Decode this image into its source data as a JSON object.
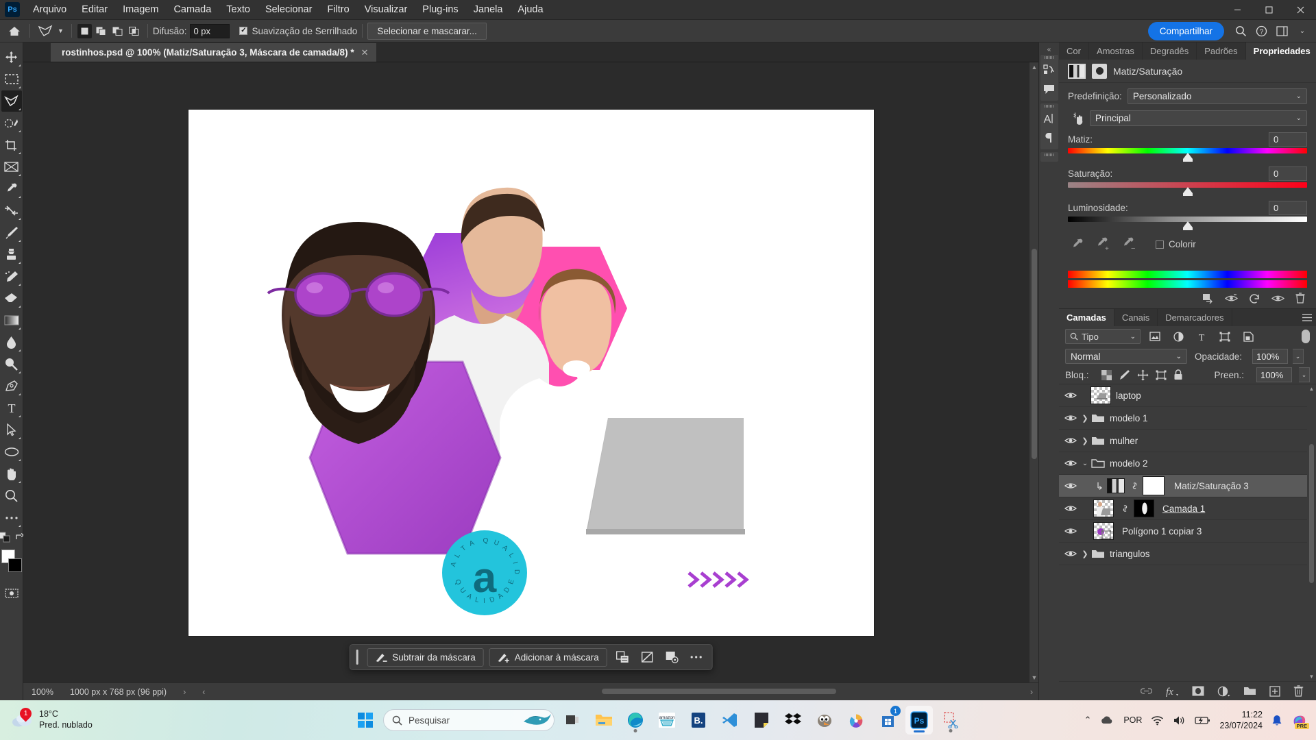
{
  "app": {
    "name": "Photoshop",
    "logo_text": "Ps"
  },
  "menubar": {
    "items": [
      "Arquivo",
      "Editar",
      "Imagem",
      "Camada",
      "Texto",
      "Selecionar",
      "Filtro",
      "Visualizar",
      "Plug-ins",
      "Janela",
      "Ajuda"
    ],
    "window_controls": {
      "minimize": "—",
      "maximize": "▢",
      "close": "✕"
    }
  },
  "optionsbar": {
    "diffusion_label": "Difusão:",
    "diffusion_value": "0 px",
    "antialias_label": "Suavização de Serrilhado",
    "select_mask_button": "Selecionar e mascarar...",
    "share_button": "Compartilhar",
    "icons": [
      "home-icon",
      "lasso-tool-preset-icon",
      "selection-new-icon",
      "selection-add-icon",
      "selection-subtract-icon",
      "selection-intersect-icon",
      "search-icon",
      "help-icon",
      "workspace-icon",
      "more-icon"
    ]
  },
  "toolbar": {
    "tools": [
      {
        "name": "move-tool",
        "active": false
      },
      {
        "name": "marquee-tool",
        "active": false
      },
      {
        "name": "lasso-tool",
        "active": true
      },
      {
        "name": "object-selection-tool",
        "active": false
      },
      {
        "name": "crop-tool",
        "active": false
      },
      {
        "name": "frame-tool",
        "active": false
      },
      {
        "name": "eyedropper-tool",
        "active": false
      },
      {
        "name": "healing-brush-tool",
        "active": false
      },
      {
        "name": "brush-tool",
        "active": false
      },
      {
        "name": "clone-stamp-tool",
        "active": false
      },
      {
        "name": "history-brush-tool",
        "active": false
      },
      {
        "name": "eraser-tool",
        "active": false
      },
      {
        "name": "gradient-tool",
        "active": false
      },
      {
        "name": "blur-tool",
        "active": false
      },
      {
        "name": "dodge-tool",
        "active": false
      },
      {
        "name": "pen-tool",
        "active": false
      },
      {
        "name": "type-tool",
        "active": false
      },
      {
        "name": "path-selection-tool",
        "active": false
      },
      {
        "name": "ellipse-tool",
        "active": false
      },
      {
        "name": "hand-tool",
        "active": false
      },
      {
        "name": "zoom-tool",
        "active": false
      },
      {
        "name": "more-tools",
        "active": false
      }
    ],
    "foreground_color": "#ffffff",
    "background_color": "#000000"
  },
  "document": {
    "tab_title": "rostinhos.psd @ 100% (Matiz/Saturação 3, Máscara de camada/8) *",
    "close_label": "✕",
    "zoom": "100%",
    "dimensions": "1000 px x 768 px (96 ppi)"
  },
  "mask_toolbar": {
    "subtract_label": "Subtrair da máscara",
    "add_label": "Adicionar à máscara",
    "icons": [
      "mask-settings-icon",
      "mask-disable-icon",
      "mask-apply-icon",
      "more-options-icon"
    ]
  },
  "minidock": {
    "collapse_label": "«",
    "icons": [
      "libraries-icon",
      "comments-icon",
      "character-icon",
      "paragraph-icon"
    ]
  },
  "properties": {
    "tabs": [
      "Cor",
      "Amostras",
      "Degradês",
      "Padrões",
      "Propriedades"
    ],
    "active_tab": "Propriedades",
    "adjustment_title": "Matiz/Saturação",
    "preset_label": "Predefinição:",
    "preset_value": "Personalizado",
    "channel_value": "Principal",
    "sliders": [
      {
        "label": "Matiz:",
        "value": "0",
        "track": "hue"
      },
      {
        "label": "Saturação:",
        "value": "0",
        "track": "saturation"
      },
      {
        "label": "Luminosidade:",
        "value": "0",
        "track": "lightness"
      }
    ],
    "colorize_label": "Colorir",
    "colorize_checked": false,
    "footer_icons": [
      "clip-to-layer-icon",
      "toggle-visibility-prev-icon",
      "reset-icon",
      "toggle-layer-visibility-icon",
      "delete-icon"
    ]
  },
  "layers": {
    "tabs": [
      "Camadas",
      "Canais",
      "Demarcadores"
    ],
    "active_tab": "Camadas",
    "filter_label": "Tipo",
    "filter_icons": [
      "pixel-filter-icon",
      "adjustment-filter-icon",
      "type-filter-icon",
      "shape-filter-icon",
      "smart-object-filter-icon"
    ],
    "blend_mode": "Normal",
    "opacity_label": "Opacidade:",
    "opacity_value": "100%",
    "lock_label": "Bloq.:",
    "lock_icons": [
      "lock-transparency-icon",
      "lock-image-icon",
      "lock-position-icon",
      "lock-artboard-icon",
      "lock-all-icon"
    ],
    "fill_label": "Preen.:",
    "fill_value": "100%",
    "rows": [
      {
        "name": "laptop",
        "type": "layer",
        "indent": 0,
        "selected": false,
        "thumb": "transparent",
        "has_disclosure": false
      },
      {
        "name": "modelo 1",
        "type": "group",
        "indent": 0,
        "selected": false,
        "collapsed": true
      },
      {
        "name": "mulher",
        "type": "group",
        "indent": 0,
        "selected": false,
        "collapsed": true
      },
      {
        "name": "modelo 2",
        "type": "group",
        "indent": 0,
        "selected": false,
        "collapsed": false
      },
      {
        "name": "Matiz/Saturação 3",
        "type": "adjustment",
        "indent": 1,
        "selected": true,
        "clipped": true,
        "linked": true,
        "mask": "white"
      },
      {
        "name": "Camada 1",
        "type": "layer",
        "indent": 1,
        "selected": false,
        "linked": true,
        "mask": "black",
        "underlined": true
      },
      {
        "name": "Polígono 1 copiar 3",
        "type": "shape",
        "indent": 1,
        "selected": false
      },
      {
        "name": "triangulos",
        "type": "group",
        "indent": 0,
        "selected": false,
        "collapsed": true
      }
    ],
    "footer_icons": [
      "link-layers-icon",
      "layer-style-fx-icon",
      "add-mask-icon",
      "new-adjustment-layer-icon",
      "new-group-icon",
      "new-layer-icon",
      "delete-layer-icon"
    ]
  },
  "taskbar": {
    "weather_temp": "18°C",
    "weather_desc": "Pred. nublado",
    "weather_badge": "1",
    "search_placeholder": "Pesquisar",
    "apps": [
      {
        "name": "start-button",
        "label": "Windows"
      },
      {
        "name": "taskview-icon",
        "label": "Task View"
      },
      {
        "name": "file-explorer-icon",
        "label": "Explorador de Arquivos"
      },
      {
        "name": "edge-icon",
        "label": "Microsoft Edge"
      },
      {
        "name": "amazon-icon",
        "label": "Amazon"
      },
      {
        "name": "booking-icon",
        "label": "Booking"
      },
      {
        "name": "vscode-icon",
        "label": "Visual Studio Code"
      },
      {
        "name": "notes-icon",
        "label": "Notas"
      },
      {
        "name": "dropbox-icon",
        "label": "Dropbox"
      },
      {
        "name": "gimp-icon",
        "label": "GIMP"
      },
      {
        "name": "krita-icon",
        "label": "Krita"
      },
      {
        "name": "microsoft-store-icon",
        "label": "Microsoft Store",
        "badge": "1"
      },
      {
        "name": "photoshop-icon",
        "label": "Photoshop",
        "active": true
      },
      {
        "name": "snipping-tool-icon",
        "label": "Ferramenta de Captura"
      }
    ],
    "tray": {
      "chevron": "⌃",
      "onedrive": "cloud-icon",
      "language": "POR",
      "wifi": "wifi-icon",
      "volume": "volume-icon",
      "battery": "battery-charging-icon",
      "time": "11:22",
      "date": "23/07/2024",
      "notification": "bell-icon",
      "copilot": "copilot-icon",
      "copilot_badge": "PRE"
    }
  },
  "colors": {
    "accent_blue": "#1473e6",
    "panel_bg": "#3b3b3b",
    "dark_bg": "#2b2b2b",
    "canvas_white": "#ffffff",
    "artwork_magenta": "#ff4fb0",
    "artwork_purple": "#b44fd0",
    "artwork_cyan": "#23c4dc"
  }
}
